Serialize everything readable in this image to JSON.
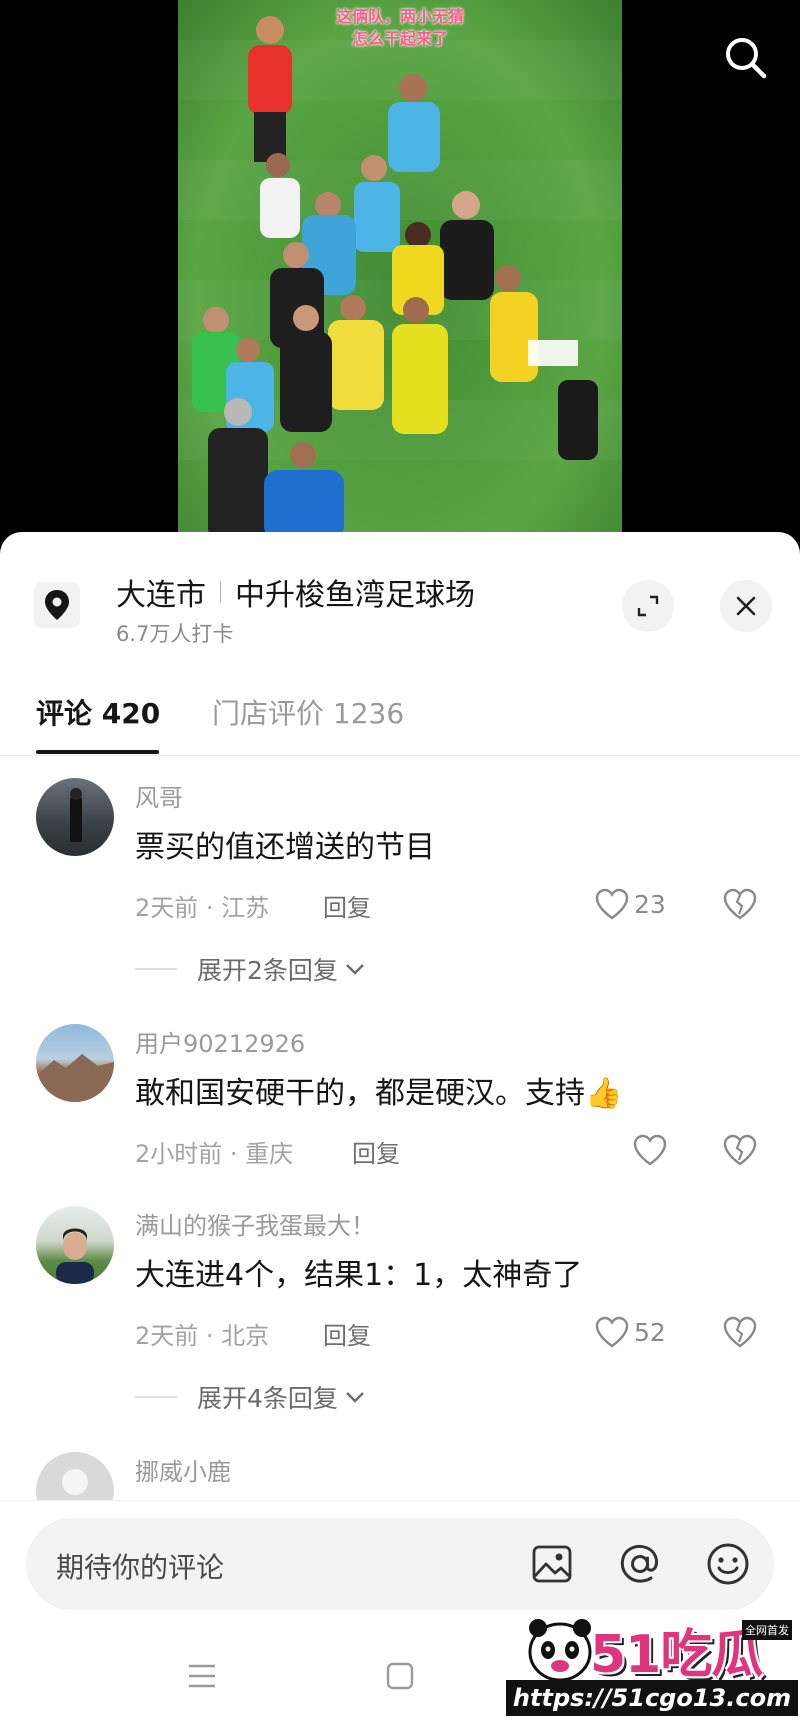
{
  "video": {
    "caption_line1": "这俩队，两小无猜",
    "caption_line2": "怎么干起来了"
  },
  "location": {
    "city": "大连市",
    "venue": "中升梭鱼湾足球场",
    "checkins": "6.7万人打卡"
  },
  "tabs": [
    {
      "label": "评论 420",
      "active": true
    },
    {
      "label": "门店评价 1236",
      "active": false
    }
  ],
  "comments": [
    {
      "user": "风哥",
      "text": "票买的值还增送的节目",
      "meta": "2天前 · 江苏",
      "reply": "回复",
      "likes": "23",
      "expand": "展开2条回复"
    },
    {
      "user": "用户90212926",
      "text": "敢和国安硬干的，都是硬汉。支持",
      "emoji": "👍",
      "meta": "2小时前 · 重庆",
      "reply": "回复",
      "likes": ""
    },
    {
      "user": "满山的猴子我蛋最大！",
      "text": "大连进4个，结果1：1，太神奇了",
      "meta": "2天前 · 北京",
      "reply": "回复",
      "likes": "52",
      "expand": "展开4条回复"
    },
    {
      "user": "挪威小鹿"
    }
  ],
  "input": {
    "placeholder": "期待你的评论"
  },
  "watermark": {
    "brand": "51吃瓜",
    "badge": "全网首发",
    "url": "https://51cgo13.com"
  },
  "colors": {
    "accent": "#161616",
    "muted": "#9a9a9a",
    "watermark_pink": "#e0357c"
  }
}
